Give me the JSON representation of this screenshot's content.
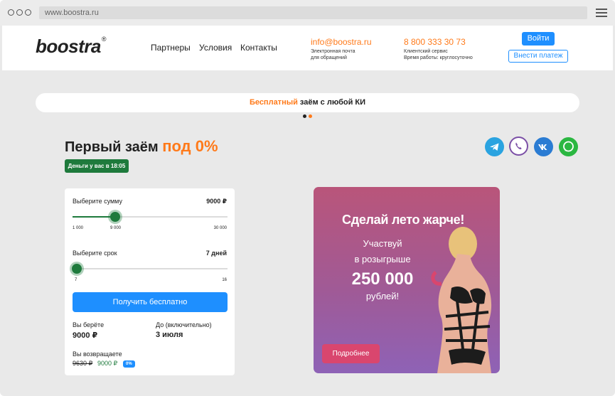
{
  "browser": {
    "url": "www.boostra.ru"
  },
  "header": {
    "logo": "boostra",
    "logo_mark": "®",
    "nav": [
      "Партнеры",
      "Условия",
      "Контакты"
    ],
    "email": {
      "value": "info@boostra.ru",
      "sub1": "Электронная почта",
      "sub2": "для обращений"
    },
    "phone": {
      "value": "8 800 333 30 73",
      "sub1": "Клиентский сервис",
      "sub2": "Время работы: круглосуточно"
    },
    "login_label": "Войти",
    "pay_label": "Внести платеж"
  },
  "banner": {
    "highlight": "Бесплатный",
    "text": " заём с любой КИ",
    "pages": 2,
    "active_page": 1
  },
  "hero": {
    "title": "Первый заём ",
    "title_highlight": "под 0%",
    "badge": "Деньги у вас в 18:05"
  },
  "social": [
    "telegram-icon",
    "viber-icon",
    "vk-icon",
    "whatsapp-icon"
  ],
  "calculator": {
    "amount": {
      "label": "Выберите сумму",
      "value_text": "9000 ₽",
      "min": "1 000",
      "current": "9 000",
      "max": "30 000",
      "level": 0.2759
    },
    "term": {
      "label": "Выберите срок",
      "value_text": "7 дней",
      "min": "7",
      "max": "16",
      "level": 0
    },
    "submit_label": "Получить бесплатно",
    "take_label": "Вы берёте",
    "take_value": "9000 ₽",
    "until_label": "До (включительно)",
    "until_value": "3 июля",
    "return_label": "Вы возвращаете",
    "return_old": "9630 ₽",
    "return_new": "9000 ₽",
    "return_badge": "0%"
  },
  "promo": {
    "title": "Сделай лето жарче!",
    "line1": "Участвуй",
    "line2": "в розыгрыше",
    "amount": "250 000",
    "line3": "рублей!",
    "button": "Подробнее"
  },
  "colors": {
    "accent": "#ff7a1a",
    "primary": "#1e8fff",
    "green": "#1e7a3c"
  }
}
